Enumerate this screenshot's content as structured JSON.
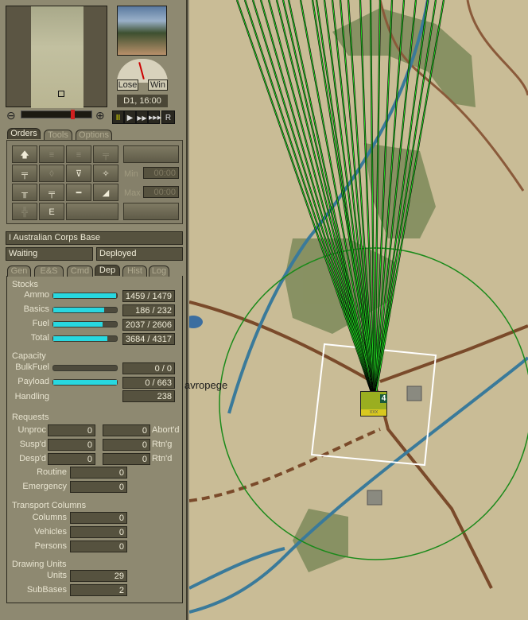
{
  "header": {
    "clock": "D1, 16:00",
    "lose_label": "Lose",
    "win_label": "Win"
  },
  "playback": {
    "buttons": [
      "II",
      "▶",
      "▶▶",
      "▶▶▶",
      "R"
    ]
  },
  "order_tabs": [
    "Orders",
    "Tools",
    "Options"
  ],
  "orders": {
    "min_label": "Min",
    "max_label": "Max",
    "min_value": "00:00",
    "max_value": "00:00"
  },
  "unit": {
    "name": "I Australian Corps Base",
    "status": "Waiting",
    "posture": "Deployed"
  },
  "info_tabs": [
    "Gen",
    "E&S",
    "Cmd",
    "Dep",
    "Hist",
    "Log"
  ],
  "stocks": {
    "title": "Stocks",
    "rows": [
      {
        "label": "Ammo",
        "value": "1459 / 1479",
        "fill": 0.986
      },
      {
        "label": "Basics",
        "value": "186 / 232",
        "fill": 0.8
      },
      {
        "label": "Fuel",
        "value": "2037 / 2606",
        "fill": 0.78
      },
      {
        "label": "Total",
        "value": "3684 / 4317",
        "fill": 0.85
      }
    ]
  },
  "capacity": {
    "title": "Capacity",
    "rows": [
      {
        "label": "BulkFuel",
        "value": "0 / 0",
        "fill": 0
      },
      {
        "label": "Payload",
        "value": "0 / 663",
        "fill": 1.0
      }
    ],
    "handling_label": "Handling",
    "handling_value": "238"
  },
  "requests": {
    "title": "Requests",
    "left": [
      {
        "label": "Unproc",
        "value": "0"
      },
      {
        "label": "Susp'd",
        "value": "0"
      },
      {
        "label": "Desp'd",
        "value": "0"
      }
    ],
    "right": [
      {
        "label": "Abort'd",
        "value": "0"
      },
      {
        "label": "Rtn'g",
        "value": "0"
      },
      {
        "label": "Rtn'd",
        "value": "0"
      }
    ],
    "routine_label": "Routine",
    "routine_value": "0",
    "emergency_label": "Emergency",
    "emergency_value": "0"
  },
  "transport": {
    "title": "Transport Columns",
    "rows": [
      {
        "label": "Columns",
        "value": "0"
      },
      {
        "label": "Vehicles",
        "value": "0"
      },
      {
        "label": "Persons",
        "value": "0"
      }
    ]
  },
  "drawing": {
    "title": "Drawing Units",
    "rows": [
      {
        "label": "Units",
        "value": "29"
      },
      {
        "label": "SubBases",
        "value": "2"
      }
    ]
  },
  "map": {
    "place_label": "avropege",
    "unit_counter": {
      "badge": "4",
      "size": "xxx"
    },
    "colors": {
      "range": "#1a8a1a",
      "lines": "#22dd22",
      "road": "#7a4a2a",
      "river": "#3a7a9a"
    }
  }
}
